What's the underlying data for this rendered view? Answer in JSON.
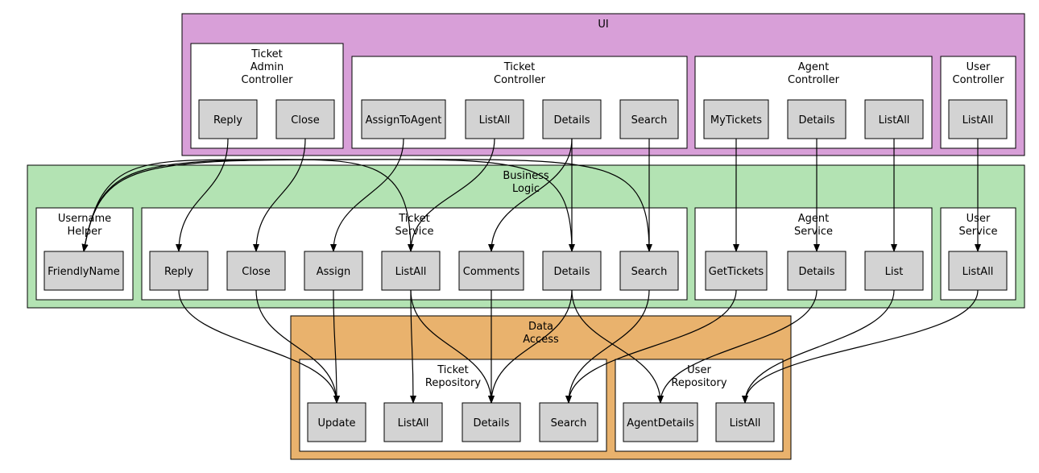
{
  "colors": {
    "ui": "#d89fd8",
    "business": "#b3e3b3",
    "data": "#e9b26d",
    "node": "#d3d3d3",
    "inner": "#ffffff"
  },
  "clusters": [
    {
      "id": "ui",
      "label": [
        "UI"
      ],
      "fill": "ui"
    },
    {
      "id": "tac",
      "label": [
        "Ticket",
        "Admin",
        "Controller"
      ],
      "fill": "inner"
    },
    {
      "id": "tc",
      "label": [
        "Ticket",
        "Controller"
      ],
      "fill": "inner"
    },
    {
      "id": "ac",
      "label": [
        "Agent",
        "Controller"
      ],
      "fill": "inner"
    },
    {
      "id": "uc",
      "label": [
        "User",
        "Controller"
      ],
      "fill": "inner"
    },
    {
      "id": "bl",
      "label": [
        "Business",
        "Logic"
      ],
      "fill": "business"
    },
    {
      "id": "uh",
      "label": [
        "Username",
        "Helper"
      ],
      "fill": "inner"
    },
    {
      "id": "ts",
      "label": [
        "Ticket",
        "Service"
      ],
      "fill": "inner"
    },
    {
      "id": "as",
      "label": [
        "Agent",
        "Service"
      ],
      "fill": "inner"
    },
    {
      "id": "us",
      "label": [
        "User",
        "Service"
      ],
      "fill": "inner"
    },
    {
      "id": "da",
      "label": [
        "Data",
        "Access"
      ],
      "fill": "data"
    },
    {
      "id": "tr",
      "label": [
        "Ticket",
        "Repository"
      ],
      "fill": "inner"
    },
    {
      "id": "ur",
      "label": [
        "User",
        "Repository"
      ],
      "fill": "inner"
    }
  ],
  "nodes": [
    {
      "id": "tac_reply",
      "label": "Reply"
    },
    {
      "id": "tac_close",
      "label": "Close"
    },
    {
      "id": "tc_assign",
      "label": "AssignToAgent"
    },
    {
      "id": "tc_listall",
      "label": "ListAll"
    },
    {
      "id": "tc_details",
      "label": "Details"
    },
    {
      "id": "tc_search",
      "label": "Search"
    },
    {
      "id": "ac_my",
      "label": "MyTickets"
    },
    {
      "id": "ac_details",
      "label": "Details"
    },
    {
      "id": "ac_listall",
      "label": "ListAll"
    },
    {
      "id": "uc_listall",
      "label": "ListAll"
    },
    {
      "id": "uh_friendly",
      "label": "FriendlyName"
    },
    {
      "id": "ts_reply",
      "label": "Reply"
    },
    {
      "id": "ts_close",
      "label": "Close"
    },
    {
      "id": "ts_assign",
      "label": "Assign"
    },
    {
      "id": "ts_listall",
      "label": "ListAll"
    },
    {
      "id": "ts_comments",
      "label": "Comments"
    },
    {
      "id": "ts_details",
      "label": "Details"
    },
    {
      "id": "ts_search",
      "label": "Search"
    },
    {
      "id": "as_get",
      "label": "GetTickets"
    },
    {
      "id": "as_details",
      "label": "Details"
    },
    {
      "id": "as_list",
      "label": "List"
    },
    {
      "id": "us_listall",
      "label": "ListAll"
    },
    {
      "id": "tr_update",
      "label": "Update"
    },
    {
      "id": "tr_listall",
      "label": "ListAll"
    },
    {
      "id": "tr_details",
      "label": "Details"
    },
    {
      "id": "tr_search",
      "label": "Search"
    },
    {
      "id": "ur_agent",
      "label": "AgentDetails"
    },
    {
      "id": "ur_listall",
      "label": "ListAll"
    }
  ],
  "edges": [
    [
      "tac_reply",
      "ts_reply"
    ],
    [
      "tac_close",
      "ts_close"
    ],
    [
      "tc_assign",
      "ts_assign"
    ],
    [
      "tc_listall",
      "ts_listall"
    ],
    [
      "tc_details",
      "ts_comments"
    ],
    [
      "tc_details",
      "ts_details"
    ],
    [
      "tc_search",
      "ts_search"
    ],
    [
      "ac_my",
      "as_get"
    ],
    [
      "ac_details",
      "as_details"
    ],
    [
      "ac_listall",
      "as_list"
    ],
    [
      "uc_listall",
      "us_listall"
    ],
    [
      "ts_listall",
      "uh_friendly"
    ],
    [
      "ts_details",
      "uh_friendly"
    ],
    [
      "ts_search",
      "uh_friendly"
    ],
    [
      "ts_reply",
      "tr_update"
    ],
    [
      "ts_close",
      "tr_update"
    ],
    [
      "ts_assign",
      "tr_update"
    ],
    [
      "ts_listall",
      "tr_listall"
    ],
    [
      "ts_listall",
      "tr_details"
    ],
    [
      "ts_comments",
      "tr_details"
    ],
    [
      "ts_details",
      "tr_details"
    ],
    [
      "ts_details",
      "ur_agent"
    ],
    [
      "ts_search",
      "tr_search"
    ],
    [
      "as_get",
      "tr_search"
    ],
    [
      "as_details",
      "ur_agent"
    ],
    [
      "as_list",
      "ur_listall"
    ],
    [
      "us_listall",
      "ur_listall"
    ]
  ]
}
